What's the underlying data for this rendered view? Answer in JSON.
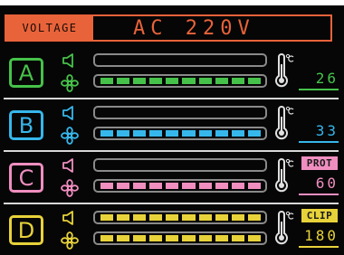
{
  "voltage": {
    "label": "VOLTAGE",
    "value": "AC 220V",
    "color": "#e8633a"
  },
  "channels": [
    {
      "letter": "A",
      "color": "#46c24a",
      "level_top": 0.0,
      "level_bottom": 1.0,
      "temperature": "26",
      "badge": "",
      "badge_color": ""
    },
    {
      "letter": "B",
      "color": "#36b7ec",
      "level_top": 0.0,
      "level_bottom": 1.0,
      "temperature": "33",
      "badge": "",
      "badge_color": ""
    },
    {
      "letter": "C",
      "color": "#f08ec0",
      "level_top": 0.0,
      "level_bottom": 1.0,
      "temperature": "60",
      "badge": "PROT",
      "badge_color": "#f08ec0"
    },
    {
      "letter": "D",
      "color": "#e8d23a",
      "level_top": 1.0,
      "level_bottom": 1.0,
      "temperature": "180",
      "badge": "CLIP",
      "badge_color": "#e8d23a"
    }
  ],
  "icons": {
    "speaker": "speaker-icon",
    "fan": "fan-icon",
    "thermometer": "thermometer-icon"
  }
}
